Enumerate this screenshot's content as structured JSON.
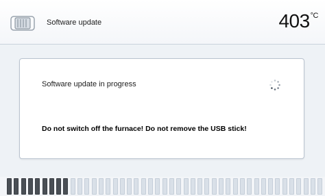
{
  "header": {
    "icon": "furnace-icon",
    "title": "Software update",
    "temperature": "403",
    "unit": "°C"
  },
  "dialog": {
    "progress_message": "Software update in progress",
    "spinner_icon": "loading-spinner-icon",
    "warning": "Do not switch off the furnace! Do not remove the USB stick!"
  },
  "progress": {
    "total_segments": 45,
    "filled_segments": 9,
    "fraction": 0.2,
    "filled_color": "#4a4f55",
    "empty_color": "#d9e0e8"
  }
}
